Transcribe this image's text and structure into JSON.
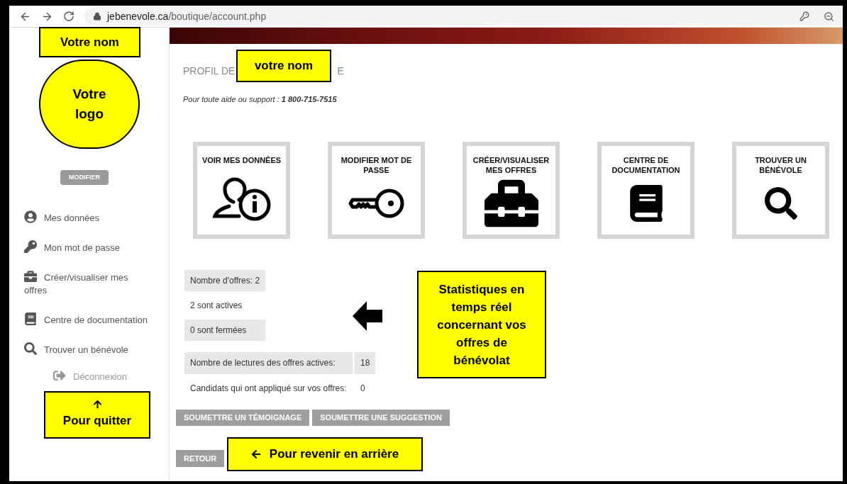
{
  "browser": {
    "url_host": "jebenevole.ca",
    "url_path": "/boutique/account.php"
  },
  "sidebar": {
    "logo": "Votre logo",
    "edit_button": "MODIFIER",
    "nav": [
      {
        "label": "Mes données"
      },
      {
        "label": "Mon mot de passe"
      },
      {
        "label": "Créer/visualiser mes offres"
      },
      {
        "label": "Centre de documentation"
      },
      {
        "label": "Trouver un bénévole"
      }
    ],
    "logout": "Déconnexion"
  },
  "main": {
    "title_parts": [
      "PROFIL DE",
      "E"
    ],
    "support": {
      "label": "Pour toute aide ou support :",
      "phone": "1 800-715-7515"
    },
    "tiles": [
      {
        "label": "VOIR MES DONNÉES"
      },
      {
        "label": "MODIFIER MOT DE PASSE"
      },
      {
        "label": "CRÉER/VISUALISER MES OFFRES"
      },
      {
        "label": "CENTRE DE DOCUMENTATION"
      },
      {
        "label": "TROUVER UN BÉNÉVOLE"
      }
    ],
    "stats": [
      {
        "kind": "shaded",
        "label": "Nombre d'offres: 2"
      },
      {
        "kind": "plain",
        "label": "2 sont actives"
      },
      {
        "kind": "shaded",
        "label": "0 sont fermées"
      },
      {
        "kind": "shaded-pair",
        "label": "Nombre de lectures des offres actives:",
        "value": "18"
      },
      {
        "kind": "plain-pair",
        "label": "Candidats qui ont appliqué sur vos offres:",
        "value": "0"
      }
    ],
    "buttons": [
      "SOUMETTRE UN TÉMOIGNAGE",
      "SOUMETTRE UNE SUGGESTION"
    ],
    "back_button": "RETOUR"
  },
  "annotations": [
    {
      "text": "Votre nom",
      "kind": "plain"
    },
    {
      "text": "votre nom",
      "kind": "plain"
    },
    {
      "text": "Statistiques en temps réel concernant vos offres de bénévolat",
      "kind": "plain"
    },
    {
      "text": "Pour quitter",
      "kind": "up"
    },
    {
      "text": "Pour revenir en arrière",
      "kind": "left"
    }
  ]
}
